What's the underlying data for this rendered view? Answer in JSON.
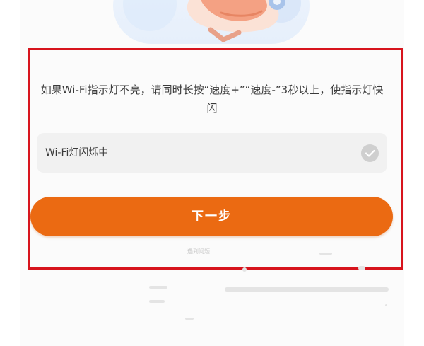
{
  "instruction": {
    "text": "如果Wi-Fi指示灯不亮，请同时长按“速度+”“速度-”3秒以上，使指示灯快闪"
  },
  "status_option": {
    "label": "Wi-Fi灯闪烁中",
    "checked": true,
    "icon": "check-circle-icon"
  },
  "next_button": {
    "label": "下一步"
  },
  "footer": {
    "link_text": "遇到问题"
  },
  "colors": {
    "accent": "#eb6a12",
    "highlight_border": "#d7141d",
    "option_background": "#f1f1f1",
    "check_icon": "#cfcfcf"
  }
}
